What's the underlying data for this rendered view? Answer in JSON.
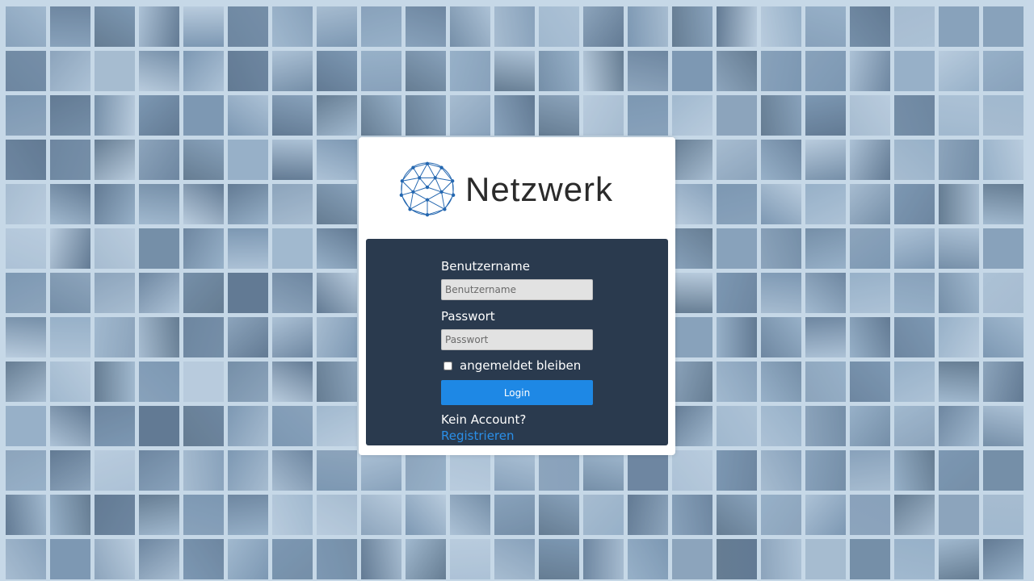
{
  "brand": {
    "name": "Netzwerk",
    "logo_icon": "network-sphere-icon",
    "logo_color": "#2467b0"
  },
  "login": {
    "username_label": "Benutzername",
    "username_placeholder": "Benutzername",
    "username_value": "",
    "password_label": "Passwort",
    "password_placeholder": "Passwort",
    "password_value": "",
    "remember_label": "angemeldet bleiben",
    "remember_checked": false,
    "submit_label": "Login",
    "no_account_text": "Kein Account?",
    "register_link": "Registrieren"
  },
  "colors": {
    "panel": "#2a3a4e",
    "button": "#1e88e5",
    "link": "#2a8fe8",
    "background": "#c9d8e6"
  },
  "background": {
    "type": "photo-mosaic",
    "columns": 23,
    "rows": 13
  }
}
